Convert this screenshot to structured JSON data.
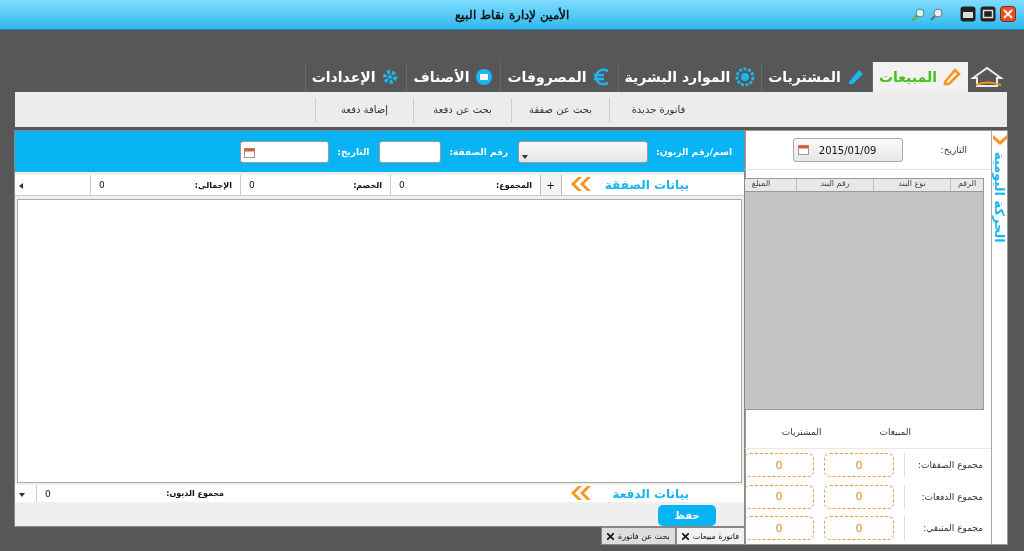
{
  "window": {
    "title": "الأمين لإدارة نقاط البيع"
  },
  "nav_tabs": [
    {
      "label": "المبيعات",
      "selected": true
    },
    {
      "label": "المشتريات",
      "selected": false
    },
    {
      "label": "الموارد البشرية",
      "selected": false
    },
    {
      "label": "المصروفات",
      "selected": false
    },
    {
      "label": "الأصناف",
      "selected": false
    },
    {
      "label": "الإعدادات",
      "selected": false
    }
  ],
  "toolbar": {
    "buttons": [
      "فاتورة جديدة",
      "بحث عن صفقة",
      "بحث عن دفعة",
      "إضافة دفعة"
    ]
  },
  "transaction_form": {
    "fields": [
      {
        "label": "اسم/رقم الزبون:",
        "kind": "dropdown"
      },
      {
        "label": "رقم الصفقة:",
        "kind": "text"
      },
      {
        "label": "التاريخ:",
        "kind": "date"
      }
    ]
  },
  "transaction_summary": {
    "title": "بيانات الصفقة",
    "add": "+",
    "totals": [
      {
        "label": "المجموع:",
        "value": "0"
      },
      {
        "label": "الخصم:",
        "value": "0"
      },
      {
        "label": "الإجمالي:",
        "value": "0"
      }
    ]
  },
  "payment_summary": {
    "title": "بيانات الدفعة",
    "totals": [
      {
        "label": "مجموع الديون:",
        "value": "0"
      }
    ]
  },
  "save_button": "حفظ",
  "doc_tabs": [
    {
      "label": "فاتورة مبيعات",
      "selected": true
    },
    {
      "label": "بحث عن فاتورة",
      "selected": false
    }
  ],
  "daily_panel": {
    "title": "الحركة اليومية",
    "date_label": "التاريخ:",
    "date": "2015/01/09",
    "table": {
      "columns": [
        "الرقم",
        "نوع البند",
        "رقم البند",
        "المبلغ"
      ]
    },
    "columns": [
      "المبيعات",
      "المشتريات"
    ],
    "rows": [
      {
        "label": "مجموع الصفقات:",
        "values": [
          "0",
          "0"
        ]
      },
      {
        "label": "مجموع الدفعات:",
        "values": [
          "0",
          "0"
        ]
      },
      {
        "label": "مجموع المتبقي:",
        "values": [
          "0",
          "0"
        ]
      }
    ]
  }
}
